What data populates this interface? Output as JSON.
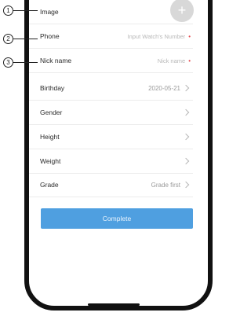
{
  "form": {
    "image_label": "Image",
    "phone_label": "Phone",
    "phone_placeholder": "Input Watch's Number",
    "nickname_label": "Nick name",
    "nickname_placeholder": "Nick name",
    "birthday_label": "Birthday",
    "birthday_value": "2020-05-21",
    "gender_label": "Gender",
    "height_label": "Height",
    "weight_label": "Weight",
    "grade_label": "Grade",
    "grade_value": "Grade first",
    "required_mark": "•",
    "avatar_add_glyph": "+"
  },
  "actions": {
    "complete_label": "Complete"
  },
  "callouts": [
    "1",
    "2",
    "3"
  ],
  "colors": {
    "accent": "#4f9fe0",
    "required": "#e5484d"
  },
  "icons": {
    "row_chevron": "chevron-right-icon",
    "avatar_add": "plus-icon"
  }
}
